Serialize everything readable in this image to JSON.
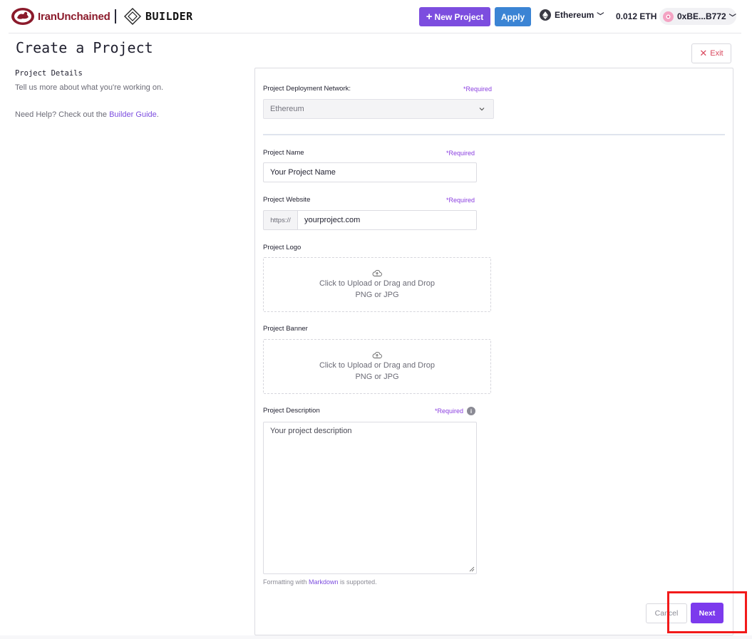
{
  "header": {
    "logo_text": "IranUnchained",
    "builder_text": "BUILDER",
    "new_project_label": "New Project",
    "apply_label": "Apply",
    "network_label": "Ethereum",
    "balance": "0.012 ETH",
    "wallet_address": "0xBE...B772"
  },
  "page": {
    "title": "Create a Project",
    "exit_label": "Exit",
    "section_label": "Project Details",
    "section_description": "Tell us more about what you're working on.",
    "help_text": "Need Help? Check out the ",
    "help_link": "Builder Guide",
    "help_suffix": "."
  },
  "form": {
    "network": {
      "label": "Project Deployment Network:",
      "required": "*Required",
      "value": "Ethereum"
    },
    "name": {
      "label": "Project Name",
      "required": "*Required",
      "placeholder": "Your Project Name"
    },
    "website": {
      "label": "Project Website",
      "required": "*Required",
      "prefix": "https://",
      "placeholder": "yourproject.com"
    },
    "logo": {
      "label": "Project Logo",
      "upload_text": "Click to Upload or Drag and Drop",
      "formats": "PNG or JPG"
    },
    "banner": {
      "label": "Project Banner",
      "upload_text": "Click to Upload or Drag and Drop",
      "formats": "PNG or JPG"
    },
    "description": {
      "label": "Project Description",
      "required": "*Required",
      "placeholder": "Your project description",
      "note_prefix": "Formatting with ",
      "note_link": "Markdown",
      "note_suffix": " is supported."
    },
    "cancel_label": "Cancel",
    "next_label": "Next"
  },
  "colors": {
    "primary": "#7c4ddf",
    "apply": "#3b84d4",
    "required": "#8a3ee0",
    "highlight": "#f21a1a"
  }
}
